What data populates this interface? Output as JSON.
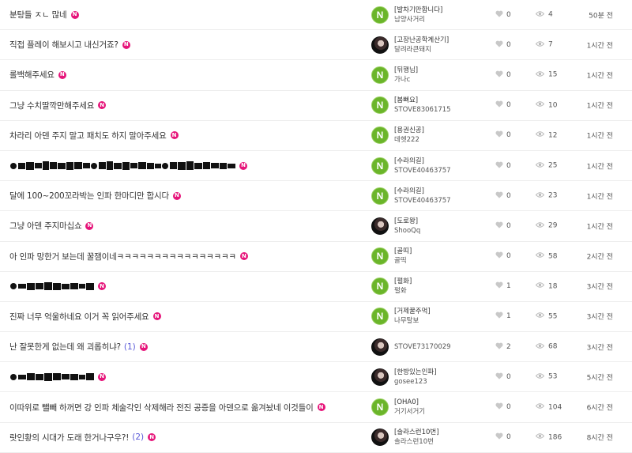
{
  "new_badge": "N",
  "avatar_letter": "N",
  "posts": [
    {
      "title": "분탕들 ㅈㄴ 많네",
      "title_type": "text",
      "comments": "",
      "avatar": "n",
      "guild": "[발차기만합니다]",
      "author": "남양사거리",
      "likes": "0",
      "views": "4",
      "time": "50분 전"
    },
    {
      "title": "직접 플레이 해보시고 내신거죠?",
      "title_type": "text",
      "comments": "",
      "avatar": "photo",
      "guild": "[고장난공학계산기]",
      "author": "달려라큰돼지",
      "likes": "0",
      "views": "7",
      "time": "1시간 전"
    },
    {
      "title": "롤백해주세요",
      "title_type": "text",
      "comments": "",
      "avatar": "n",
      "guild": "[뒤행님]",
      "author": "가나c",
      "likes": "0",
      "views": "15",
      "time": "1시간 전"
    },
    {
      "title": "그냥 수치딸깍만해주세요",
      "title_type": "text",
      "comments": "",
      "avatar": "n",
      "guild": "[봄뻐요]",
      "author": "STOVE83061715",
      "likes": "0",
      "views": "10",
      "time": "1시간 전"
    },
    {
      "title": "차라리 아덴 주지 말고 패치도 하지 말아주세요",
      "title_type": "text",
      "comments": "",
      "avatar": "n",
      "guild": "[용권신공]",
      "author": "데헷222",
      "likes": "0",
      "views": "12",
      "time": "1시간 전"
    },
    {
      "title": "",
      "title_type": "censored-long",
      "comments": "",
      "avatar": "n",
      "guild": "[수라의길]",
      "author": "STOVE40463757",
      "likes": "0",
      "views": "25",
      "time": "1시간 전"
    },
    {
      "title": "달에 100~200꼬라박는 인파 한마디만 합시다",
      "title_type": "text",
      "comments": "",
      "avatar": "n",
      "guild": "[수라의길]",
      "author": "STOVE40463757",
      "likes": "0",
      "views": "23",
      "time": "1시간 전"
    },
    {
      "title": "그냥 아덴 주지마십쇼",
      "title_type": "text",
      "comments": "",
      "avatar": "photo",
      "guild": "[도로왕]",
      "author": "ShooQq",
      "likes": "0",
      "views": "29",
      "time": "1시간 전"
    },
    {
      "title": "아 인파 망한거 보는데 꿀잼이네ㅋㅋㅋㅋㅋㅋㅋㅋㅋㅋㅋㅋㅋㅋㅋㅋ",
      "title_type": "text",
      "comments": "",
      "avatar": "n",
      "guild": "[골띠]",
      "author": "골띡",
      "likes": "0",
      "views": "58",
      "time": "2시간 전"
    },
    {
      "title": "",
      "title_type": "censored-short",
      "comments": "",
      "avatar": "n",
      "guild": "[펄화]",
      "author": "펄화",
      "likes": "1",
      "views": "18",
      "time": "3시간 전"
    },
    {
      "title": "진짜 너무 억울하네요 이거 꼭 읽어주세요",
      "title_type": "text",
      "comments": "",
      "avatar": "n",
      "guild": "[거제꿀주먹]",
      "author": "나무탈보",
      "likes": "1",
      "views": "55",
      "time": "3시간 전"
    },
    {
      "title": "난 잘못한게 없는데 왜 괴롭히냐?",
      "title_type": "text",
      "comments": "(1)",
      "avatar": "photo",
      "guild": "",
      "author": "STOVE73170029",
      "likes": "2",
      "views": "68",
      "time": "3시간 전"
    },
    {
      "title": "",
      "title_type": "censored-short",
      "comments": "",
      "avatar": "photo",
      "guild": "[한방있는인파]",
      "author": "gosee123",
      "likes": "0",
      "views": "53",
      "time": "5시간 전"
    },
    {
      "title": "이따위로 뺄빼 하꺼면 강 인파 체술각인 삭제해라 전진 공증을 아덴으로 옮겨놨네 이것들이",
      "title_type": "text",
      "comments": "",
      "avatar": "n",
      "guild": "[OHA0]",
      "author": "거기서거기",
      "likes": "0",
      "views": "104",
      "time": "6시간 전"
    },
    {
      "title": "랏인황의 시대가 도래 한거나구우?!",
      "title_type": "text",
      "comments": "(2)",
      "avatar": "photo",
      "guild": "[솔라스런10번]",
      "author": "솔라스런10번",
      "likes": "0",
      "views": "186",
      "time": "8시간 전"
    }
  ]
}
